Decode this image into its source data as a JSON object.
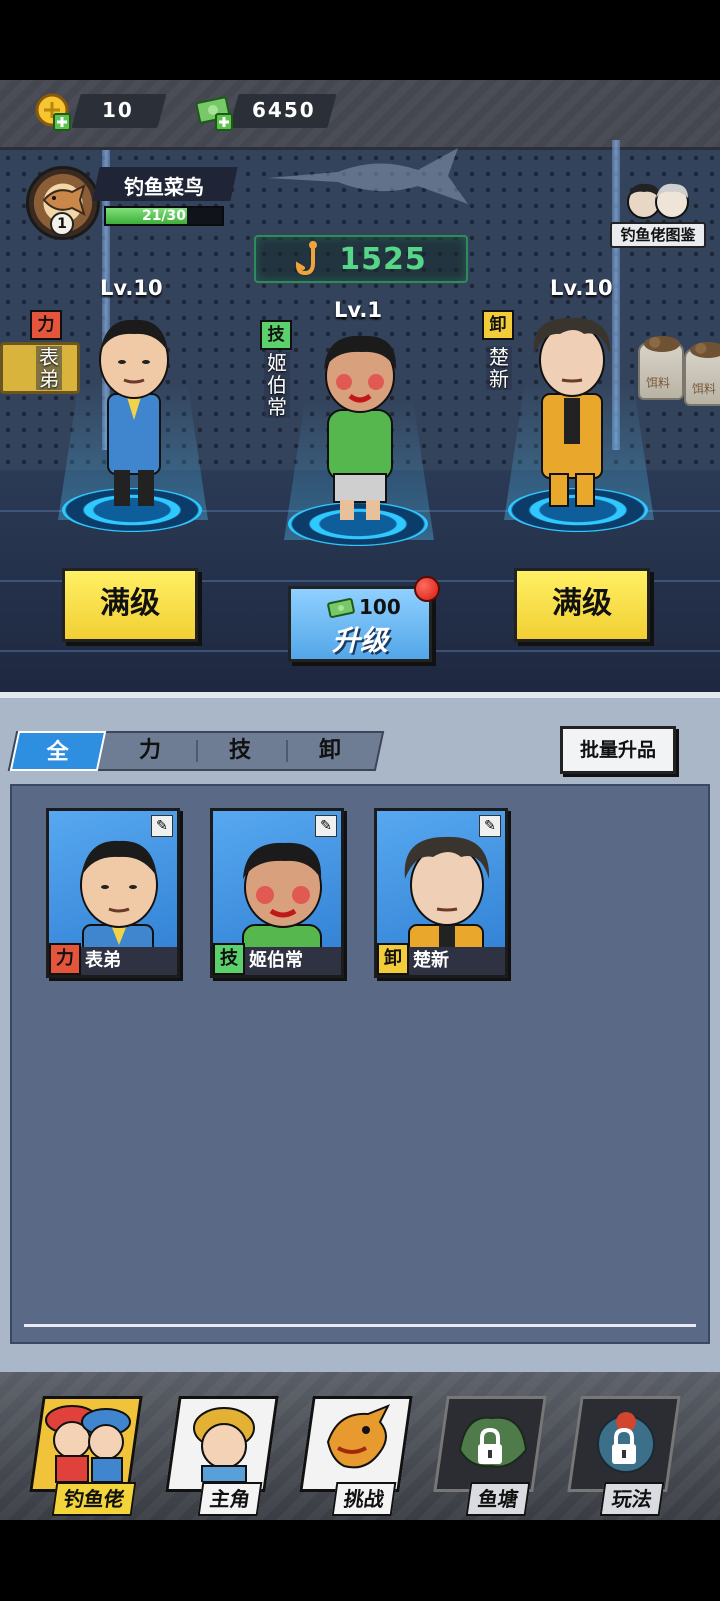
{
  "resources": {
    "gold": "10",
    "cash": "6450"
  },
  "player": {
    "level": "1",
    "name": "钓鱼菜鸟",
    "xp_text": "21/30",
    "xp_fraction": 0.7
  },
  "gallery_label": "钓鱼佬图鉴",
  "score_sign": "1525",
  "characters": [
    {
      "level": "Lv.10",
      "cls": "力",
      "name": "表弟",
      "name_v": [
        "表",
        "弟"
      ],
      "action": "满级"
    },
    {
      "level": "Lv.1",
      "cls": "技",
      "name": "姬伯常",
      "name_v": [
        "姬",
        "伯",
        "常"
      ],
      "action": "升级",
      "cost": "100"
    },
    {
      "level": "Lv.10",
      "cls": "卸",
      "name": "楚新",
      "name_v": [
        "楚",
        "新"
      ],
      "action": "满级"
    }
  ],
  "tabs": [
    "全",
    "力",
    "技",
    "卸"
  ],
  "batch_button": "批量升品",
  "bag_text": "饵料",
  "nav": [
    {
      "label": "钓鱼佬",
      "state": "active"
    },
    {
      "label": "主角",
      "state": "normal"
    },
    {
      "label": "挑战",
      "state": "normal"
    },
    {
      "label": "鱼塘",
      "state": "locked"
    },
    {
      "label": "玩法",
      "state": "locked"
    }
  ],
  "colors": {
    "class_li": "#e4553c",
    "class_ji": "#5bd06b",
    "class_xie": "#f3cd39",
    "tab_active": "#2e8ee0",
    "button_yellow": "#f2cf34",
    "button_blue": "#53a6e8",
    "sign_green": "#57d687"
  }
}
